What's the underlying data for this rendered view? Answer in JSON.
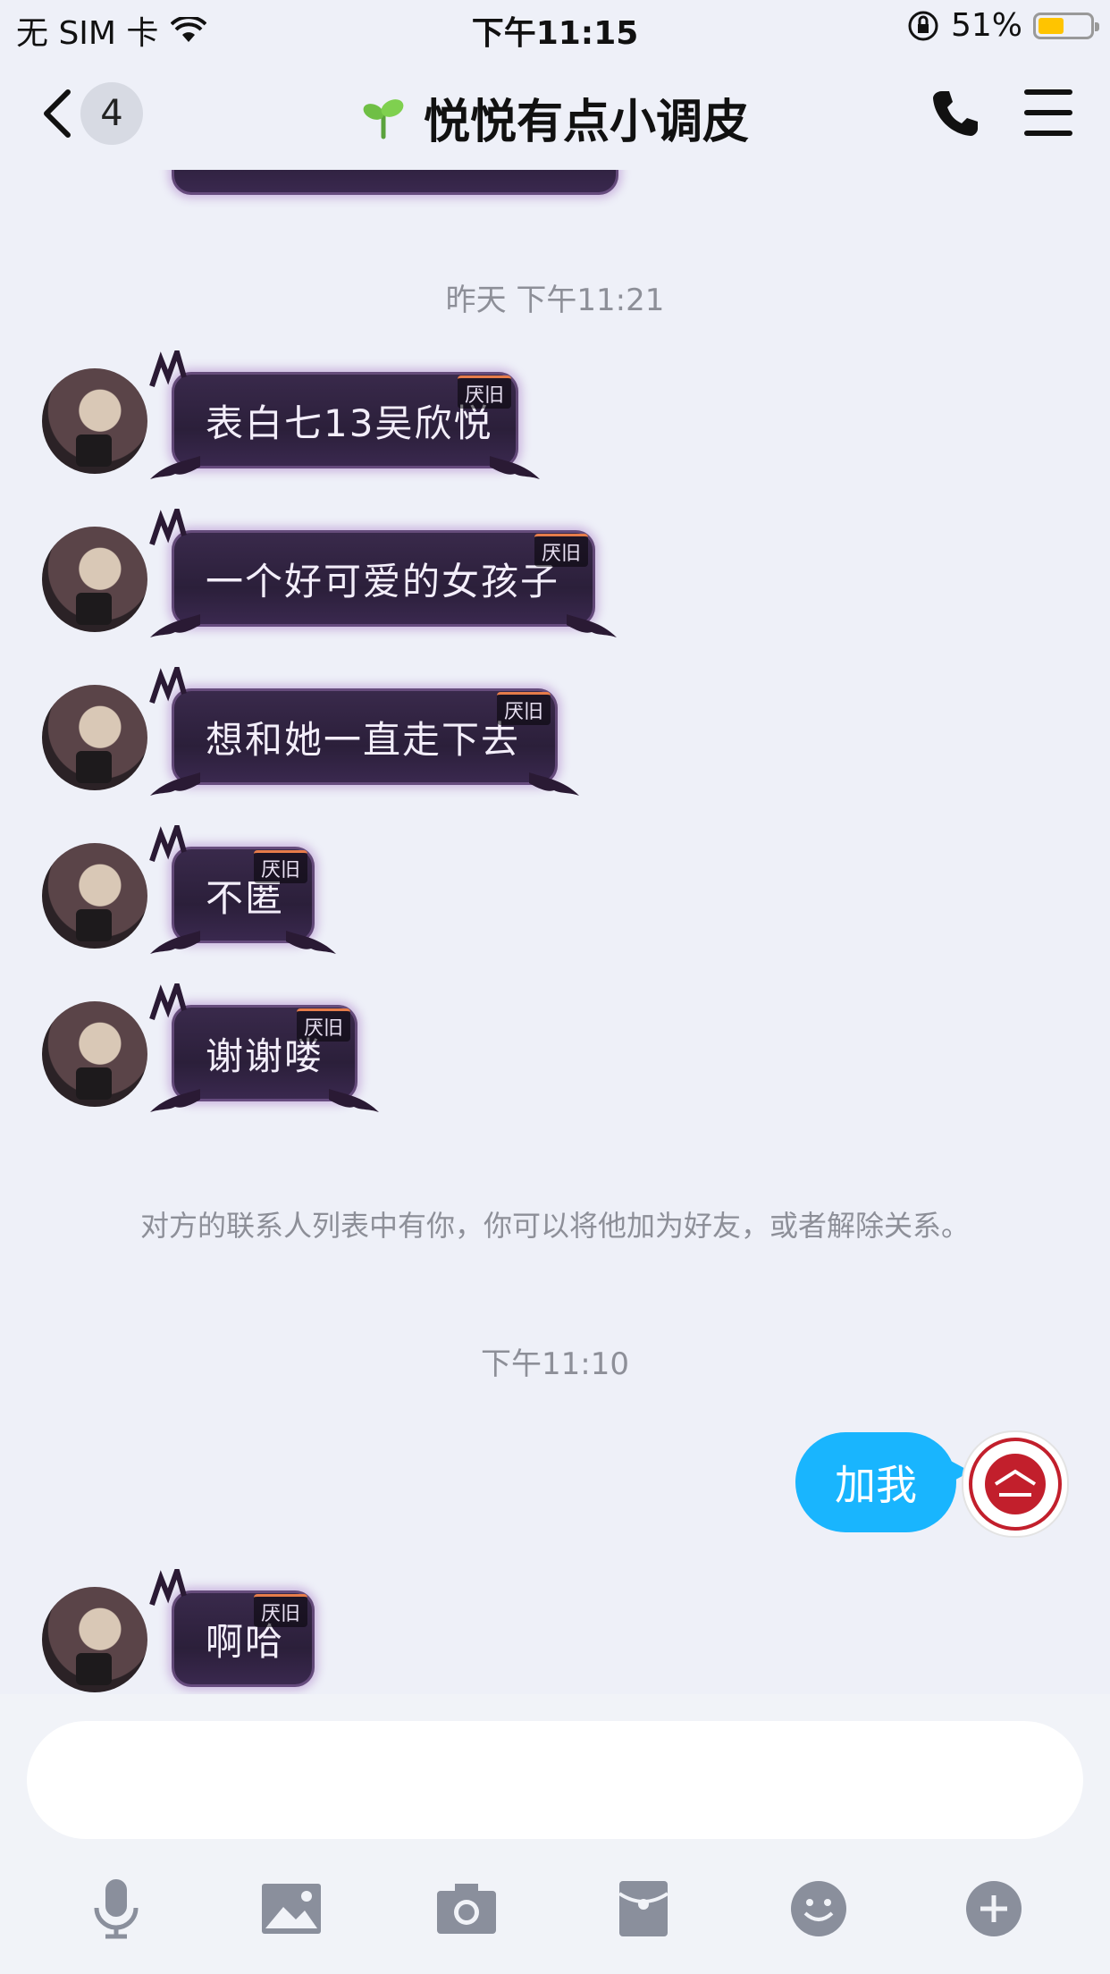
{
  "status_bar": {
    "carrier": "无 SIM 卡",
    "time": "下午11:15",
    "battery_percent": "51%",
    "battery_level": 0.51
  },
  "nav": {
    "unread_count": "4",
    "title": "悦悦有点小调皮"
  },
  "chat": {
    "timestamp_1": "昨天 下午11:21",
    "messages_in": [
      {
        "text": "表白七13吴欣悦",
        "tag": "厌旧"
      },
      {
        "text": "一个好可爱的女孩子",
        "tag": "厌旧"
      },
      {
        "text": "想和她一直走下去",
        "tag": "厌旧"
      },
      {
        "text": "不匿",
        "tag": "厌旧"
      },
      {
        "text": "谢谢喽",
        "tag": "厌旧"
      }
    ],
    "system_notice": "对方的联系人列表中有你，你可以将他加为好友，或者解除关系。",
    "timestamp_2": "下午11:10",
    "my_message": "加我",
    "last_in": {
      "text": "啊哈",
      "tag": "厌旧"
    }
  },
  "colors": {
    "my_bubble": "#19b5fe",
    "their_bubble": "#2b1f3a",
    "background": "#eef0f8"
  },
  "toolbar_icons": [
    "microphone-icon",
    "image-icon",
    "camera-icon",
    "red-packet-icon",
    "emoji-icon",
    "plus-icon"
  ]
}
